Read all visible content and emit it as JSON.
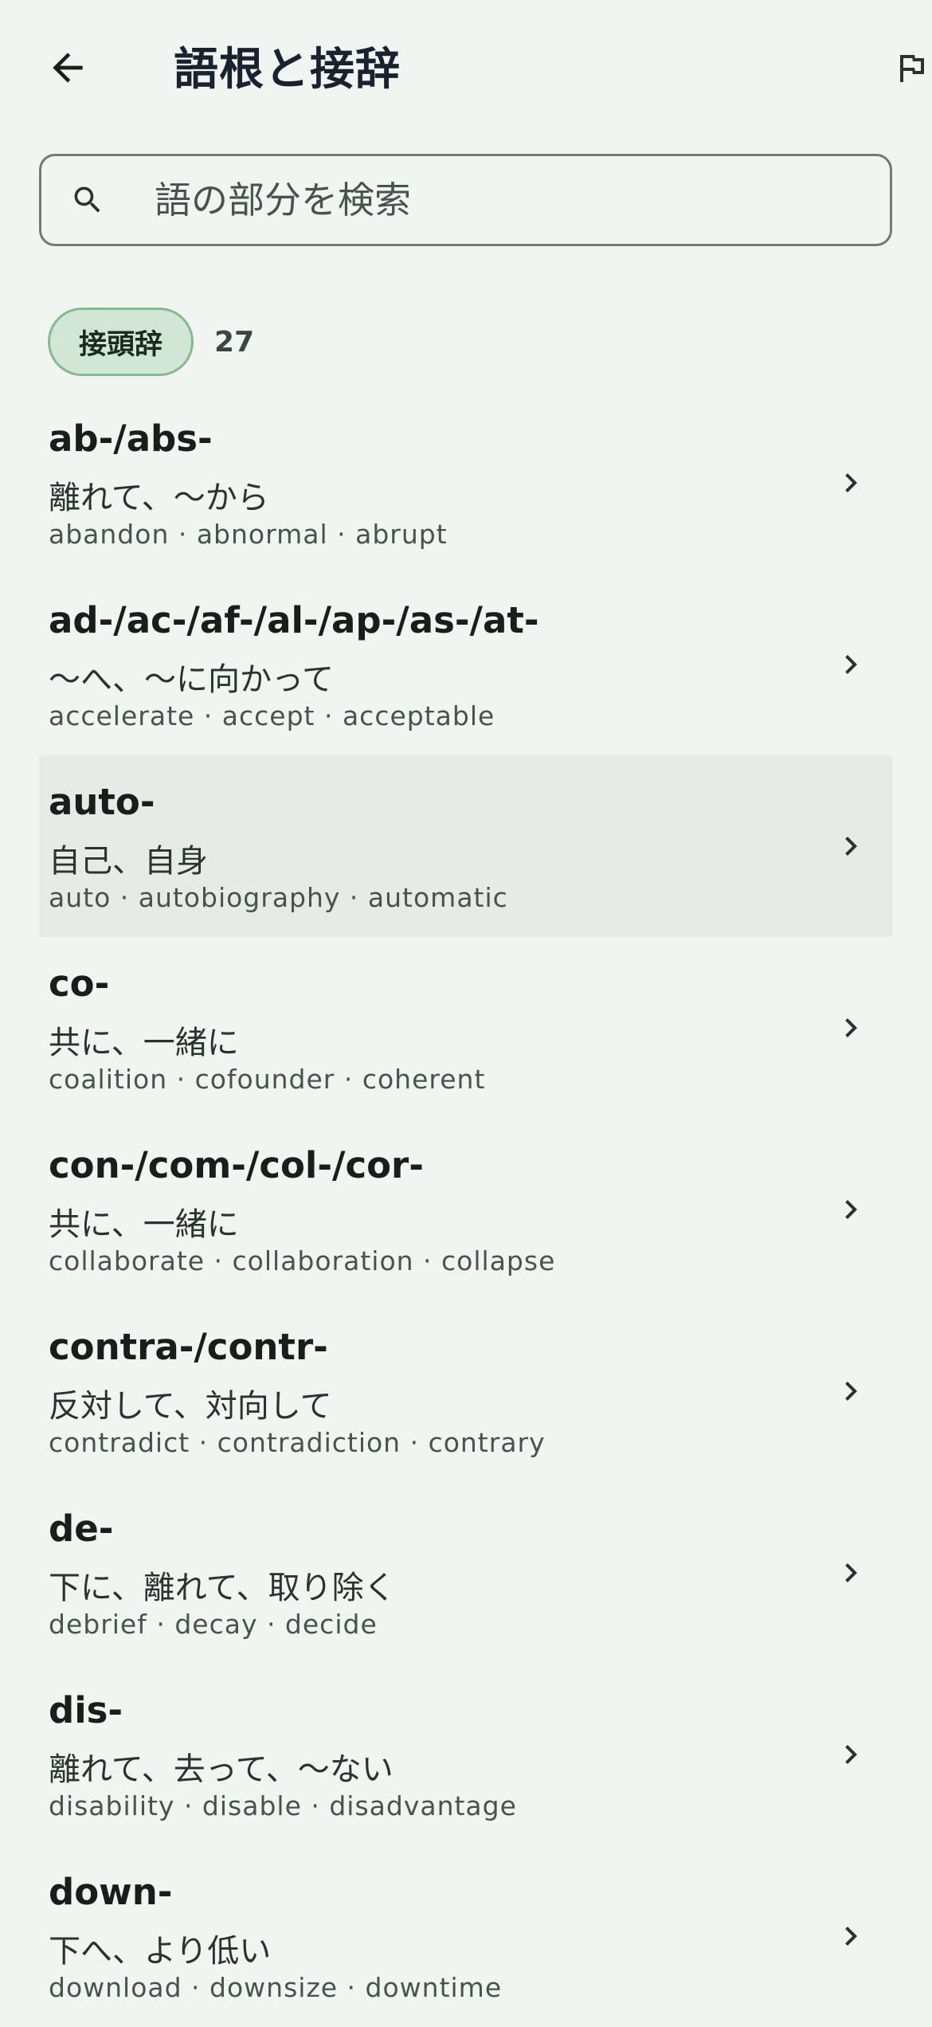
{
  "header": {
    "title": "語根と接辞"
  },
  "search": {
    "placeholder": "語の部分を検索"
  },
  "filter": {
    "chip_label": "接頭辞",
    "count": "27"
  },
  "items": [
    {
      "title": "ab-/abs-",
      "meaning": "離れて、〜から",
      "examples": "abandon · abnormal · abrupt"
    },
    {
      "title": "ad-/ac-/af-/al-/ap-/as-/at-",
      "meaning": "〜へ、〜に向かって",
      "examples": "accelerate · accept · acceptable"
    },
    {
      "title": "auto-",
      "meaning": "自己、自身",
      "examples": "auto · autobiography · automatic"
    },
    {
      "title": "co-",
      "meaning": "共に、一緒に",
      "examples": "coalition · cofounder · coherent"
    },
    {
      "title": "con-/com-/col-/cor-",
      "meaning": "共に、一緒に",
      "examples": "collaborate · collaboration · collapse"
    },
    {
      "title": "contra-/contr-",
      "meaning": "反対して、対向して",
      "examples": "contradict · contradiction · contrary"
    },
    {
      "title": "de-",
      "meaning": "下に、離れて、取り除く",
      "examples": "debrief · decay · decide"
    },
    {
      "title": "dis-",
      "meaning": "離れて、去って、〜ない",
      "examples": "disability · disable · disadvantage"
    },
    {
      "title": "down-",
      "meaning": "下へ、より低い",
      "examples": "download · downsize · downtime"
    }
  ],
  "icons": {
    "back": "arrow-back-icon",
    "flag": "flag-icon",
    "search": "search-icon",
    "chevron": "chevron-right-icon"
  },
  "colors": {
    "background": "#f1f5f1",
    "chip_fill": "#d1e6d5",
    "chip_border": "#86b990",
    "highlight_row": "#e6ebe7",
    "title_text": "#1a2230"
  }
}
